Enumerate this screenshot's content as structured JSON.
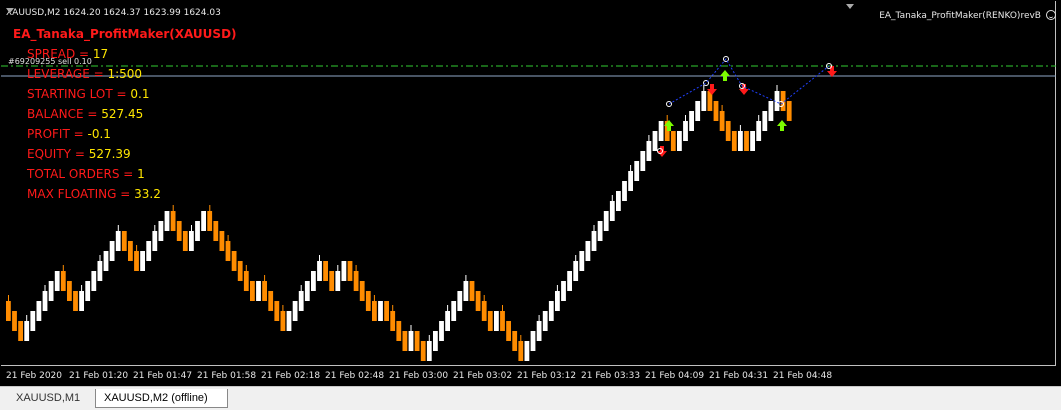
{
  "header": {
    "symbol_info": "XAUUSD,M2  1624.20 1624.37 1623.99 1624.03",
    "ea_name": "EA_Tanaka_ProfitMaker(RENKO)revB"
  },
  "panel": {
    "title": "EA_Tanaka_ProfitMaker(XAUUSD)",
    "rows": [
      {
        "label": "SPREAD = ",
        "value": "17"
      },
      {
        "label": "LEVERAGE = ",
        "value": "1:500"
      },
      {
        "label": "STARTING LOT = ",
        "value": "0.1"
      },
      {
        "label": "BALANCE = ",
        "value": "527.45"
      },
      {
        "label": "PROFIT = ",
        "value": "-0.1"
      },
      {
        "label": "EQUITY = ",
        "value": "527.39"
      },
      {
        "label": "TOTAL ORDERS = ",
        "value": "1"
      },
      {
        "label": "MAX FLOATING = ",
        "value": "33.2"
      }
    ]
  },
  "order_line_label": "#69209255 sell 0.10",
  "colors": {
    "bull": "#ffffff",
    "bear": "#ff8c00",
    "panel_label": "#ff1a1a",
    "panel_value": "#ffe600",
    "buy_arrow": "#7cfc00",
    "sell_arrow": "#ff1a1a",
    "order_line": "#32cd32",
    "price_line": "#8fa8c8"
  },
  "time_axis": [
    "21 Feb 2020",
    "21 Feb 01:20",
    "21 Feb 01:47",
    "21 Feb 01:58",
    "21 Feb 02:18",
    "21 Feb 02:48",
    "21 Feb 03:00",
    "21 Feb 03:02",
    "21 Feb 03:12",
    "21 Feb 03:33",
    "21 Feb 04:09",
    "21 Feb 04:31",
    "21 Feb 04:48"
  ],
  "chart_data": {
    "type": "renko",
    "brick_directions": "DDDUUUUUUDDDUUUUUUUDDDUUUUUDDDUUUDDDDDDDDUDDDDUUUUUUDDUUDDDDDUDDDDUDDUUUUUUUDDDDUDDDDUUUUUUUUUUUUUUUUUUUUUUUDDUUUUUDDDDDUDUUUUUDD",
    "signals": [
      {
        "type": "sell",
        "time": "21 Feb 04:09"
      },
      {
        "type": "buy",
        "time": "21 Feb 04:09"
      },
      {
        "type": "sell",
        "time": "21 Feb 04:31"
      },
      {
        "type": "buy",
        "time": "21 Feb 04:31"
      },
      {
        "type": "sell",
        "time": "21 Feb 04:31"
      },
      {
        "type": "buy",
        "time": "21 Feb 04:48"
      },
      {
        "type": "sell",
        "time": "21 Feb 04:48"
      }
    ]
  },
  "tabs": [
    {
      "label": "XAUUSD,M1",
      "active": false
    },
    {
      "label": "XAUUSD,M2 (offline)",
      "active": true
    }
  ]
}
